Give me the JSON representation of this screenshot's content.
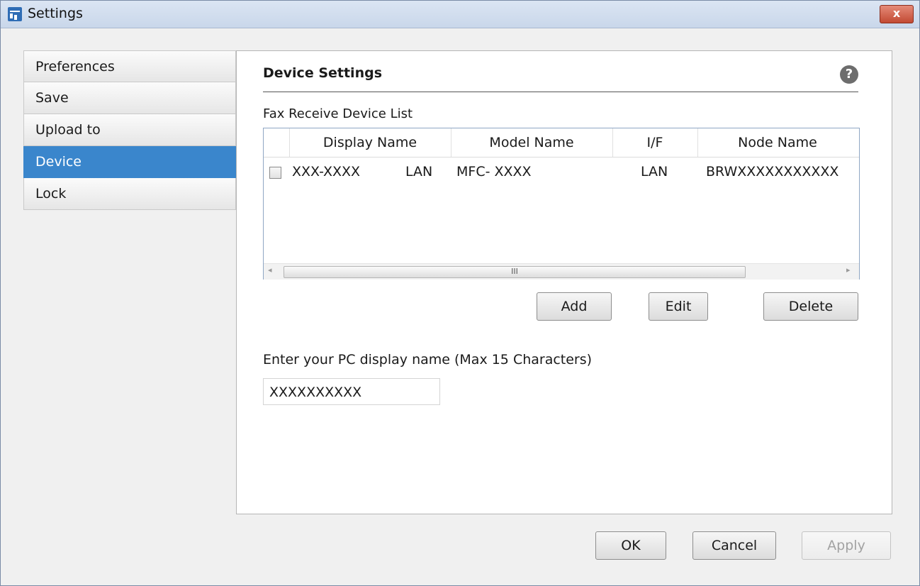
{
  "window": {
    "title": "Settings",
    "close_label": "x"
  },
  "nav": {
    "items": [
      {
        "label": "Preferences"
      },
      {
        "label": "Save"
      },
      {
        "label": "Upload to"
      },
      {
        "label": "Device",
        "selected": true
      },
      {
        "label": "Lock"
      }
    ]
  },
  "device_settings": {
    "title": "Device Settings",
    "help_icon": "?",
    "list_label": "Fax Receive Device List",
    "columns": [
      "Display Name",
      "Model Name",
      "I/F",
      "Node Name"
    ],
    "rows": [
      {
        "checked": false,
        "display_name": "XXX-XXXX",
        "display_if": "LAN",
        "model_name": "MFC- XXXX",
        "if": "LAN",
        "node_name": "BRWXXXXXXXXXXX"
      }
    ],
    "scrollbar_grip": "III",
    "buttons": {
      "add": "Add",
      "edit": "Edit",
      "delete": "Delete"
    },
    "pc_name_label": "Enter your PC display name (Max 15 Characters)",
    "pc_name_value": "XXXXXXXXXX"
  },
  "footer": {
    "ok": "OK",
    "cancel": "Cancel",
    "apply": "Apply"
  },
  "colors": {
    "selected_nav": "#3a86cc",
    "title_bar": "#d3def0"
  }
}
